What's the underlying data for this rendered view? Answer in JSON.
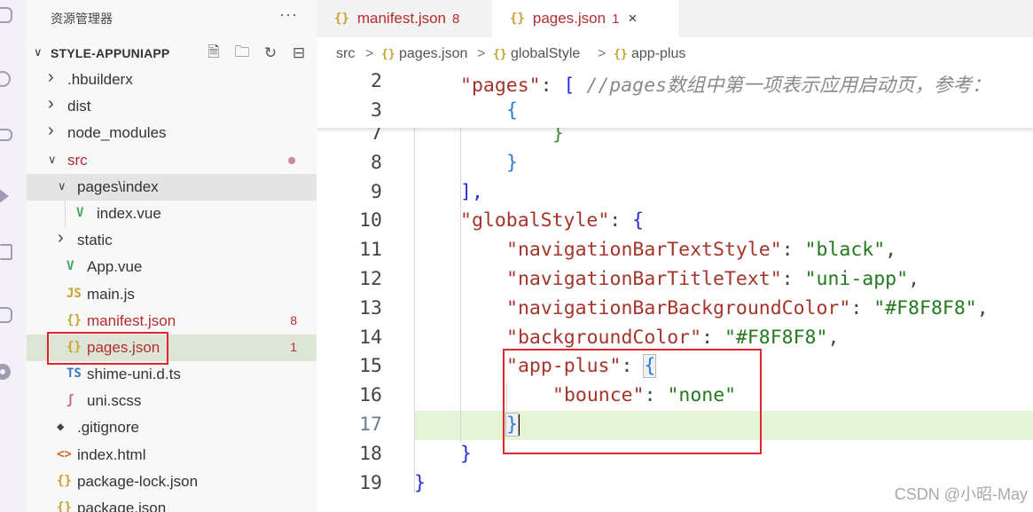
{
  "sidebar": {
    "title": "资源管理器",
    "more_label": "···",
    "project_title": "STYLE-APPUNIAPP",
    "tree": [
      {
        "label": ".hbuilderx",
        "kind": "folder",
        "depth": 1,
        "expanded": false
      },
      {
        "label": "dist",
        "kind": "folder",
        "depth": 1,
        "expanded": false
      },
      {
        "label": "node_modules",
        "kind": "folder",
        "depth": 1,
        "expanded": false
      },
      {
        "label": "src",
        "kind": "folder",
        "depth": 1,
        "expanded": true,
        "color": "#b32e2e",
        "modified_dot": true
      },
      {
        "label": "pages\\index",
        "kind": "folder",
        "depth": 2,
        "expanded": true,
        "selected": true
      },
      {
        "label": "index.vue",
        "kind": "vue",
        "depth": 3
      },
      {
        "label": "static",
        "kind": "folder",
        "depth": 2,
        "expanded": false
      },
      {
        "label": "App.vue",
        "kind": "vue",
        "depth": 2
      },
      {
        "label": "main.js",
        "kind": "js",
        "depth": 2
      },
      {
        "label": "manifest.json",
        "kind": "json",
        "depth": 2,
        "color": "#b32e2e",
        "badge": "8"
      },
      {
        "label": "pages.json",
        "kind": "json",
        "depth": 2,
        "color": "#b32e2e",
        "badge": "1",
        "active": true
      },
      {
        "label": "shime-uni.d.ts",
        "kind": "ts",
        "depth": 2
      },
      {
        "label": "uni.scss",
        "kind": "scss",
        "depth": 2
      },
      {
        "label": ".gitignore",
        "kind": "git",
        "depth": 1
      },
      {
        "label": "index.html",
        "kind": "html",
        "depth": 1
      },
      {
        "label": "package-lock.json",
        "kind": "json",
        "depth": 1
      },
      {
        "label": "package.json",
        "kind": "json",
        "depth": 1
      }
    ]
  },
  "tabs": [
    {
      "label": "manifest.json",
      "badge": "8",
      "icon": "{}",
      "active": false
    },
    {
      "label": "pages.json",
      "badge": "1",
      "icon": "{}",
      "active": true,
      "close": "×"
    }
  ],
  "breadcrumb": {
    "items": [
      "src",
      "pages.json",
      "globalStyle",
      "app-plus"
    ],
    "icon": "{}",
    "separator": ">"
  },
  "editor": {
    "current_line": 17,
    "sticky_lines": [
      {
        "n": "2",
        "indent": 1,
        "tokens": [
          [
            "key",
            "\"pages\""
          ],
          [
            "p",
            ": "
          ],
          [
            "b2",
            "["
          ],
          [
            "p",
            " "
          ],
          [
            "cm",
            "//pages数组中第一项表示应用启动页，参考："
          ]
        ]
      },
      {
        "n": "3",
        "indent": 2,
        "tokens": [
          [
            "b3",
            "{"
          ]
        ]
      }
    ],
    "lines": [
      {
        "n": "7",
        "indent": 3,
        "tokens": [
          [
            "b4",
            "}"
          ]
        ]
      },
      {
        "n": "8",
        "indent": 2,
        "tokens": [
          [
            "b3",
            "}"
          ]
        ]
      },
      {
        "n": "9",
        "indent": 1,
        "tokens": [
          [
            "b2",
            "],"
          ]
        ]
      },
      {
        "n": "10",
        "indent": 1,
        "tokens": [
          [
            "key",
            "\"globalStyle\""
          ],
          [
            "p",
            ": "
          ],
          [
            "b2",
            "{"
          ]
        ]
      },
      {
        "n": "11",
        "indent": 2,
        "tokens": [
          [
            "key",
            "\"navigationBarTextStyle\""
          ],
          [
            "p",
            ": "
          ],
          [
            "str",
            "\"black\""
          ],
          [
            "p",
            ","
          ]
        ]
      },
      {
        "n": "12",
        "indent": 2,
        "tokens": [
          [
            "key",
            "\"navigationBarTitleText\""
          ],
          [
            "p",
            ": "
          ],
          [
            "str",
            "\"uni-app\""
          ],
          [
            "p",
            ","
          ]
        ]
      },
      {
        "n": "13",
        "indent": 2,
        "tokens": [
          [
            "key",
            "\"navigationBarBackgroundColor\""
          ],
          [
            "p",
            ": "
          ],
          [
            "str",
            "\"#F8F8F8\""
          ],
          [
            "p",
            ","
          ]
        ]
      },
      {
        "n": "14",
        "indent": 2,
        "tokens": [
          [
            "key",
            "\"backgroundColor\""
          ],
          [
            "p",
            ": "
          ],
          [
            "str",
            "\"#F8F8F8\""
          ],
          [
            "p",
            ","
          ]
        ]
      },
      {
        "n": "15",
        "indent": 2,
        "tokens": [
          [
            "key",
            "\"app-plus\""
          ],
          [
            "p",
            ": "
          ],
          [
            "b3m",
            "{"
          ]
        ]
      },
      {
        "n": "16",
        "indent": 3,
        "tokens": [
          [
            "key",
            "\"bounce\""
          ],
          [
            "p",
            ": "
          ],
          [
            "str",
            "\"none\""
          ]
        ]
      },
      {
        "n": "17",
        "indent": 2,
        "tokens": [
          [
            "b3m",
            "}"
          ],
          [
            "caret",
            ""
          ]
        ]
      },
      {
        "n": "18",
        "indent": 1,
        "tokens": [
          [
            "b2",
            "}"
          ]
        ]
      },
      {
        "n": "19",
        "indent": 0,
        "tokens": [
          [
            "b2",
            "}"
          ]
        ]
      }
    ]
  },
  "watermark": "CSDN @小昭-May",
  "colors": {
    "accent_red": "#e0272f",
    "json_key": "#a5342a",
    "json_string": "#24781e",
    "current_line": "#e5f4d7"
  }
}
